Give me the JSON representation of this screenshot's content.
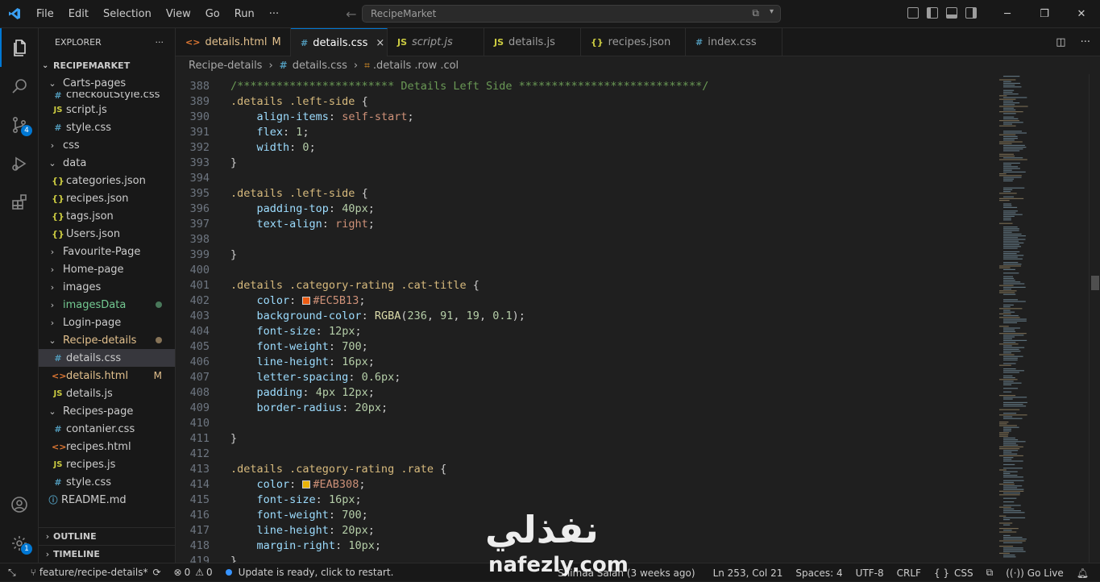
{
  "titlebar": {
    "menu": [
      "File",
      "Edit",
      "Selection",
      "View",
      "Go",
      "Run",
      "···"
    ],
    "command_center": "RecipeMarket"
  },
  "activity": {
    "source_control_badge": "4",
    "settings_badge": "1"
  },
  "explorer": {
    "title": "EXPLORER",
    "more": "···",
    "root": "RECIPEMARKET",
    "items": [
      {
        "label": "Carts-pages",
        "type": "folder-open",
        "depth": 1
      },
      {
        "label": "checkoutStyle.css",
        "type": "css",
        "depth": 2
      },
      {
        "label": "script.js",
        "type": "js",
        "depth": 2
      },
      {
        "label": "style.css",
        "type": "css",
        "depth": 2
      },
      {
        "label": "css",
        "type": "folder",
        "depth": 1
      },
      {
        "label": "data",
        "type": "folder-open",
        "depth": 1
      },
      {
        "label": "categories.json",
        "type": "json",
        "depth": 2
      },
      {
        "label": "recipes.json",
        "type": "json",
        "depth": 2
      },
      {
        "label": "tags.json",
        "type": "json",
        "depth": 2
      },
      {
        "label": "Users.json",
        "type": "json",
        "depth": 2
      },
      {
        "label": "Favourite-Page",
        "type": "folder",
        "depth": 1
      },
      {
        "label": "Home-page",
        "type": "folder",
        "depth": 1
      },
      {
        "label": "images",
        "type": "folder",
        "depth": 1
      },
      {
        "label": "imagesData",
        "type": "folder",
        "depth": 1,
        "status": "green-dot"
      },
      {
        "label": "Login-page",
        "type": "folder",
        "depth": 1
      },
      {
        "label": "Recipe-details",
        "type": "folder-open",
        "depth": 1,
        "status": "orange-dot"
      },
      {
        "label": "details.css",
        "type": "css",
        "depth": 2,
        "selected": true
      },
      {
        "label": "details.html",
        "type": "html",
        "depth": 2,
        "status": "M"
      },
      {
        "label": "details.js",
        "type": "js",
        "depth": 2
      },
      {
        "label": "Recipes-page",
        "type": "folder-open",
        "depth": 1
      },
      {
        "label": "contanier.css",
        "type": "css",
        "depth": 2
      },
      {
        "label": "recipes.html",
        "type": "html",
        "depth": 2
      },
      {
        "label": "recipes.js",
        "type": "js",
        "depth": 2
      },
      {
        "label": "style.css",
        "type": "css",
        "depth": 2
      },
      {
        "label": "README.md",
        "type": "md",
        "depth": 1
      }
    ],
    "outline": "OUTLINE",
    "timeline": "TIMELINE"
  },
  "tabs": [
    {
      "label": "details.html",
      "icon": "<>",
      "modified": "M"
    },
    {
      "label": "details.css",
      "icon": "#",
      "active": true,
      "close": "×"
    },
    {
      "label": "script.js",
      "icon": "JS",
      "italic": true
    },
    {
      "label": "details.js",
      "icon": "JS"
    },
    {
      "label": "recipes.json",
      "icon": "{}"
    },
    {
      "label": "index.css",
      "icon": "#"
    }
  ],
  "breadcrumb": {
    "folder": "Recipe-details",
    "file": "details.css",
    "symbol": ".details .row .col"
  },
  "code": [
    {
      "n": "388",
      "parts": [
        [
          "com",
          "/************************ Details Left Side ****************************/"
        ]
      ]
    },
    {
      "n": "389",
      "parts": [
        [
          "sel-c",
          ".details .left-side"
        ],
        [
          "punc",
          " {"
        ]
      ]
    },
    {
      "n": "390",
      "parts": [
        [
          "ind",
          "    "
        ],
        [
          "prop",
          "align-items"
        ],
        [
          "punc",
          ": "
        ],
        [
          "kw",
          "self-start"
        ],
        [
          "punc",
          ";"
        ]
      ]
    },
    {
      "n": "391",
      "parts": [
        [
          "ind",
          "    "
        ],
        [
          "prop",
          "flex"
        ],
        [
          "punc",
          ": "
        ],
        [
          "num",
          "1"
        ],
        [
          "punc",
          ";"
        ]
      ]
    },
    {
      "n": "392",
      "parts": [
        [
          "ind",
          "    "
        ],
        [
          "prop",
          "width"
        ],
        [
          "punc",
          ": "
        ],
        [
          "num",
          "0"
        ],
        [
          "punc",
          ";"
        ]
      ]
    },
    {
      "n": "393",
      "parts": [
        [
          "punc",
          "}"
        ]
      ]
    },
    {
      "n": "394",
      "parts": []
    },
    {
      "n": "395",
      "parts": [
        [
          "sel-c",
          ".details .left-side"
        ],
        [
          "punc",
          " {"
        ]
      ]
    },
    {
      "n": "396",
      "parts": [
        [
          "ind",
          "    "
        ],
        [
          "prop",
          "padding-top"
        ],
        [
          "punc",
          ": "
        ],
        [
          "num",
          "40px"
        ],
        [
          "punc",
          ";"
        ]
      ]
    },
    {
      "n": "397",
      "parts": [
        [
          "ind",
          "    "
        ],
        [
          "prop",
          "text-align"
        ],
        [
          "punc",
          ": "
        ],
        [
          "kw",
          "right"
        ],
        [
          "punc",
          ";"
        ]
      ]
    },
    {
      "n": "398",
      "parts": []
    },
    {
      "n": "399",
      "parts": [
        [
          "punc",
          "}"
        ]
      ]
    },
    {
      "n": "400",
      "parts": []
    },
    {
      "n": "401",
      "parts": [
        [
          "sel-c",
          ".details .category-rating .cat-title"
        ],
        [
          "punc",
          " {"
        ]
      ]
    },
    {
      "n": "402",
      "parts": [
        [
          "ind",
          "    "
        ],
        [
          "prop",
          "color"
        ],
        [
          "punc",
          ": "
        ],
        [
          "swatch",
          "#EC5B13"
        ],
        [
          "kw",
          "#EC5B13"
        ],
        [
          "punc",
          ";"
        ]
      ]
    },
    {
      "n": "403",
      "parts": [
        [
          "ind",
          "    "
        ],
        [
          "prop",
          "background-color"
        ],
        [
          "punc",
          ": "
        ],
        [
          "fn",
          "RGBA"
        ],
        [
          "punc",
          "("
        ],
        [
          "num",
          "236"
        ],
        [
          "punc",
          ", "
        ],
        [
          "num",
          "91"
        ],
        [
          "punc",
          ", "
        ],
        [
          "num",
          "19"
        ],
        [
          "punc",
          ", "
        ],
        [
          "num",
          "0.1"
        ],
        [
          "punc",
          ");"
        ]
      ]
    },
    {
      "n": "404",
      "parts": [
        [
          "ind",
          "    "
        ],
        [
          "prop",
          "font-size"
        ],
        [
          "punc",
          ": "
        ],
        [
          "num",
          "12px"
        ],
        [
          "punc",
          ";"
        ]
      ]
    },
    {
      "n": "405",
      "parts": [
        [
          "ind",
          "    "
        ],
        [
          "prop",
          "font-weight"
        ],
        [
          "punc",
          ": "
        ],
        [
          "num",
          "700"
        ],
        [
          "punc",
          ";"
        ]
      ]
    },
    {
      "n": "406",
      "parts": [
        [
          "ind",
          "    "
        ],
        [
          "prop",
          "line-height"
        ],
        [
          "punc",
          ": "
        ],
        [
          "num",
          "16px"
        ],
        [
          "punc",
          ";"
        ]
      ]
    },
    {
      "n": "407",
      "parts": [
        [
          "ind",
          "    "
        ],
        [
          "prop",
          "letter-spacing"
        ],
        [
          "punc",
          ": "
        ],
        [
          "num",
          "0.6px"
        ],
        [
          "punc",
          ";"
        ]
      ]
    },
    {
      "n": "408",
      "parts": [
        [
          "ind",
          "    "
        ],
        [
          "prop",
          "padding"
        ],
        [
          "punc",
          ": "
        ],
        [
          "num",
          "4px 12px"
        ],
        [
          "punc",
          ";"
        ]
      ]
    },
    {
      "n": "409",
      "parts": [
        [
          "ind",
          "    "
        ],
        [
          "prop",
          "border-radius"
        ],
        [
          "punc",
          ": "
        ],
        [
          "num",
          "20px"
        ],
        [
          "punc",
          ";"
        ]
      ]
    },
    {
      "n": "410",
      "parts": []
    },
    {
      "n": "411",
      "parts": [
        [
          "punc",
          "}"
        ]
      ]
    },
    {
      "n": "412",
      "parts": []
    },
    {
      "n": "413",
      "parts": [
        [
          "sel-c",
          ".details .category-rating .rate"
        ],
        [
          "punc",
          " {"
        ]
      ]
    },
    {
      "n": "414",
      "parts": [
        [
          "ind",
          "    "
        ],
        [
          "prop",
          "color"
        ],
        [
          "punc",
          ": "
        ],
        [
          "swatch",
          "#EAB308"
        ],
        [
          "kw",
          "#EAB308"
        ],
        [
          "punc",
          ";"
        ]
      ]
    },
    {
      "n": "415",
      "parts": [
        [
          "ind",
          "    "
        ],
        [
          "prop",
          "font-size"
        ],
        [
          "punc",
          ": "
        ],
        [
          "num",
          "16px"
        ],
        [
          "punc",
          ";"
        ]
      ]
    },
    {
      "n": "416",
      "parts": [
        [
          "ind",
          "    "
        ],
        [
          "prop",
          "font-weight"
        ],
        [
          "punc",
          ": "
        ],
        [
          "num",
          "700"
        ],
        [
          "punc",
          ";"
        ]
      ]
    },
    {
      "n": "417",
      "parts": [
        [
          "ind",
          "    "
        ],
        [
          "prop",
          "line-height"
        ],
        [
          "punc",
          ": "
        ],
        [
          "num",
          "20px"
        ],
        [
          "punc",
          ";"
        ]
      ]
    },
    {
      "n": "418",
      "parts": [
        [
          "ind",
          "    "
        ],
        [
          "prop",
          "margin-right"
        ],
        [
          "punc",
          ": "
        ],
        [
          "num",
          "10px"
        ],
        [
          "punc",
          ";"
        ]
      ]
    },
    {
      "n": "419",
      "parts": [
        [
          "punc",
          "}"
        ]
      ]
    }
  ],
  "statusbar": {
    "branch": "feature/recipe-details*",
    "errors": "0",
    "warnings": "0",
    "update": "Update is ready, click to restart.",
    "blame": "Shimaa Salah (3 weeks ago)",
    "position": "Ln 253, Col 21",
    "spaces": "Spaces: 4",
    "encoding": "UTF-8",
    "eol": "CRLF",
    "language": "CSS",
    "golive": "Go Live"
  },
  "watermark": {
    "arabic": "نفذلي",
    "latin": "nafezly.com"
  },
  "colors": {
    "accent": "#0078d4",
    "git_modified": "#e2c08d",
    "git_added": "#73c991"
  }
}
